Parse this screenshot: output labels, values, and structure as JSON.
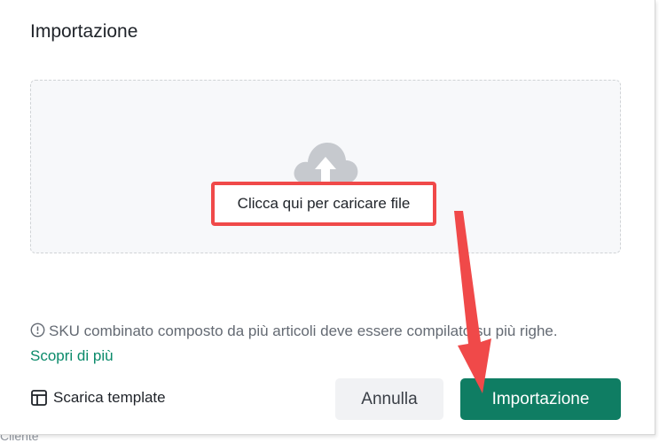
{
  "dialog": {
    "title": "Importazione",
    "backdrop_text": "Cliente"
  },
  "dropzone": {
    "icon": "cloud-upload-icon",
    "upload_label": "Clicca qui per caricare file"
  },
  "note": {
    "icon": "info-circle-icon",
    "text": "SKU combinato composto da più articoli deve essere compilato su più righe.",
    "link_text": "Scopri di più"
  },
  "footer": {
    "template_icon": "layout-icon",
    "template_label": "Scarica template",
    "cancel_label": "Annulla",
    "import_label": "Importazione"
  },
  "colors": {
    "primary": "#0f7d63",
    "link": "#0a8a6a",
    "highlight": "#f04949"
  }
}
